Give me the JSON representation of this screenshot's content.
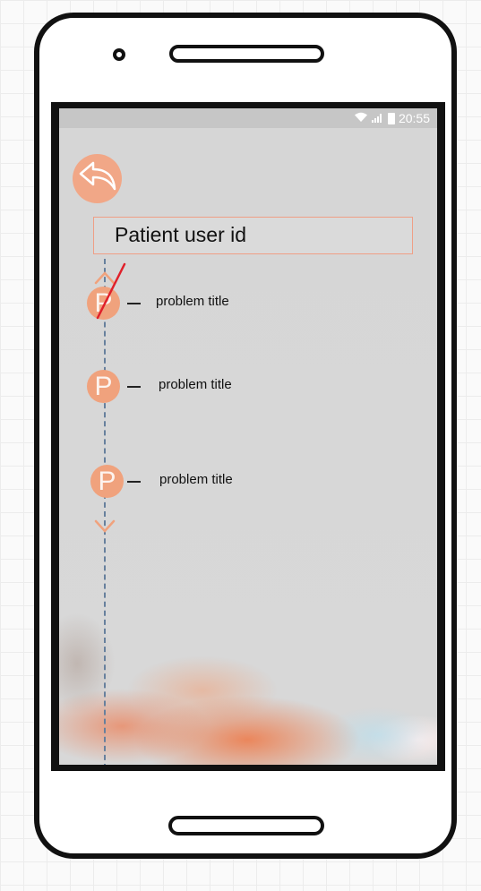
{
  "status_bar": {
    "time": "20:55",
    "icons": [
      "wifi-icon",
      "signal-icon",
      "battery-icon"
    ]
  },
  "header": {
    "back_icon": "reply-arrow-icon",
    "title": "Patient user id"
  },
  "timeline": {
    "scroll_up_icon": "chevron-up-icon",
    "scroll_down_icon": "chevron-down-icon",
    "items": [
      {
        "badge": "P",
        "label": "problem title",
        "struck_out": true
      },
      {
        "badge": "P",
        "label": "problem title",
        "struck_out": false
      },
      {
        "badge": "P",
        "label": "problem title",
        "struck_out": false
      }
    ]
  },
  "colors": {
    "accent": "#f0a27d",
    "title_border": "#ef9f86",
    "strike": "#e0202a",
    "timeline": "#67809d",
    "screen_bg": "#d6d6d6"
  }
}
